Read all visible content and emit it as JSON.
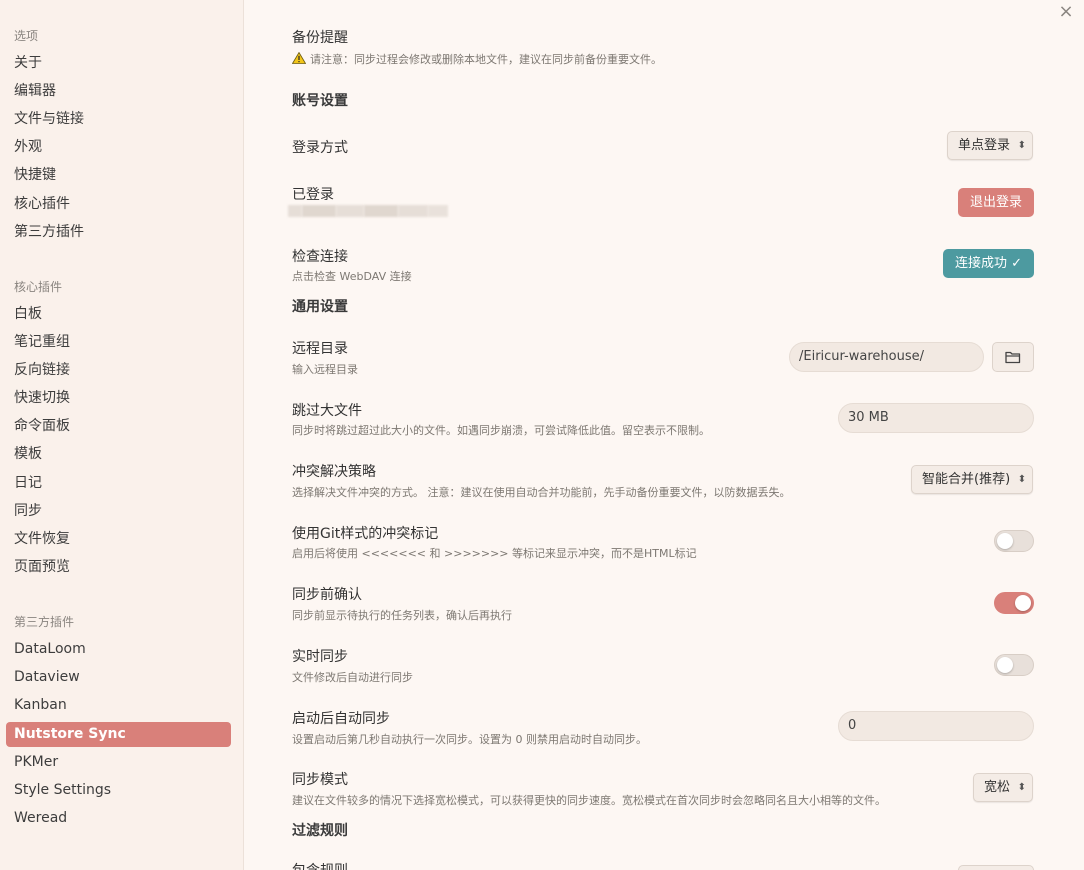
{
  "sidebar": {
    "section_options": "选项",
    "options_items": [
      "关于",
      "编辑器",
      "文件与链接",
      "外观",
      "快捷键",
      "核心插件",
      "第三方插件"
    ],
    "section_core": "核心插件",
    "core_items": [
      "白板",
      "笔记重组",
      "反向链接",
      "快速切换",
      "命令面板",
      "模板",
      "日记",
      "同步",
      "文件恢复",
      "页面预览"
    ],
    "section_third": "第三方插件",
    "third_items": [
      "DataLoom",
      "Dataview",
      "Kanban",
      "Nutstore Sync",
      "PKMer",
      "Style Settings",
      "Weread"
    ],
    "active_item": "Nutstore Sync"
  },
  "close_icon": "×",
  "content": {
    "backup": {
      "title": "备份提醒",
      "warning": "请注意：同步过程会修改或删除本地文件，建议在同步前备份重要文件。",
      "warning_icon": "warning-icon"
    },
    "account_heading": "账号设置",
    "login_method": {
      "label": "登录方式",
      "value": "单点登录"
    },
    "logged_in": {
      "label": "已登录",
      "button": "退出登录"
    },
    "check_connection": {
      "label": "检查连接",
      "desc": "点击检查 WebDAV 连接",
      "button": "连接成功 ✓"
    },
    "general_heading": "通用设置",
    "remote_dir": {
      "label": "远程目录",
      "desc": "输入远程目录",
      "value": "/Eiricur-warehouse/",
      "icon": "folder-icon"
    },
    "skip_large": {
      "label": "跳过大文件",
      "desc": "同步时将跳过超过此大小的文件。如遇同步崩溃，可尝试降低此值。留空表示不限制。",
      "value": "30 MB"
    },
    "conflict": {
      "label": "冲突解决策略",
      "desc": "选择解决文件冲突的方式。 注意：建议在使用自动合并功能前，先手动备份重要文件，以防数据丢失。",
      "value": "智能合并(推荐)"
    },
    "git_markers": {
      "label": "使用Git样式的冲突标记",
      "desc": "启用后将使用 <<<<<<< 和 >>>>>>> 等标记来显示冲突，而不是HTML标记",
      "enabled": false
    },
    "confirm_before": {
      "label": "同步前确认",
      "desc": "同步前显示待执行的任务列表，确认后再执行",
      "enabled": true
    },
    "realtime": {
      "label": "实时同步",
      "desc": "文件修改后自动进行同步",
      "enabled": false
    },
    "startup_sync": {
      "label": "启动后自动同步",
      "desc": "设置启动后第几秒自动执行一次同步。设置为 0 则禁用启动时自动同步。",
      "value": "0"
    },
    "sync_mode": {
      "label": "同步模式",
      "desc": "建议在文件较多的情况下选择宽松模式，可以获得更快的同步速度。宽松模式在首次同步时会忽略同名且大小相等的文件。",
      "value": "宽松"
    },
    "filter_heading": "过滤规则",
    "include_rules": {
      "label": "包含规则"
    }
  },
  "colors": {
    "accent": "#d9807a",
    "success": "#4d9aa0",
    "background": "#fdf7f3",
    "sidebar": "#faf1eb"
  }
}
